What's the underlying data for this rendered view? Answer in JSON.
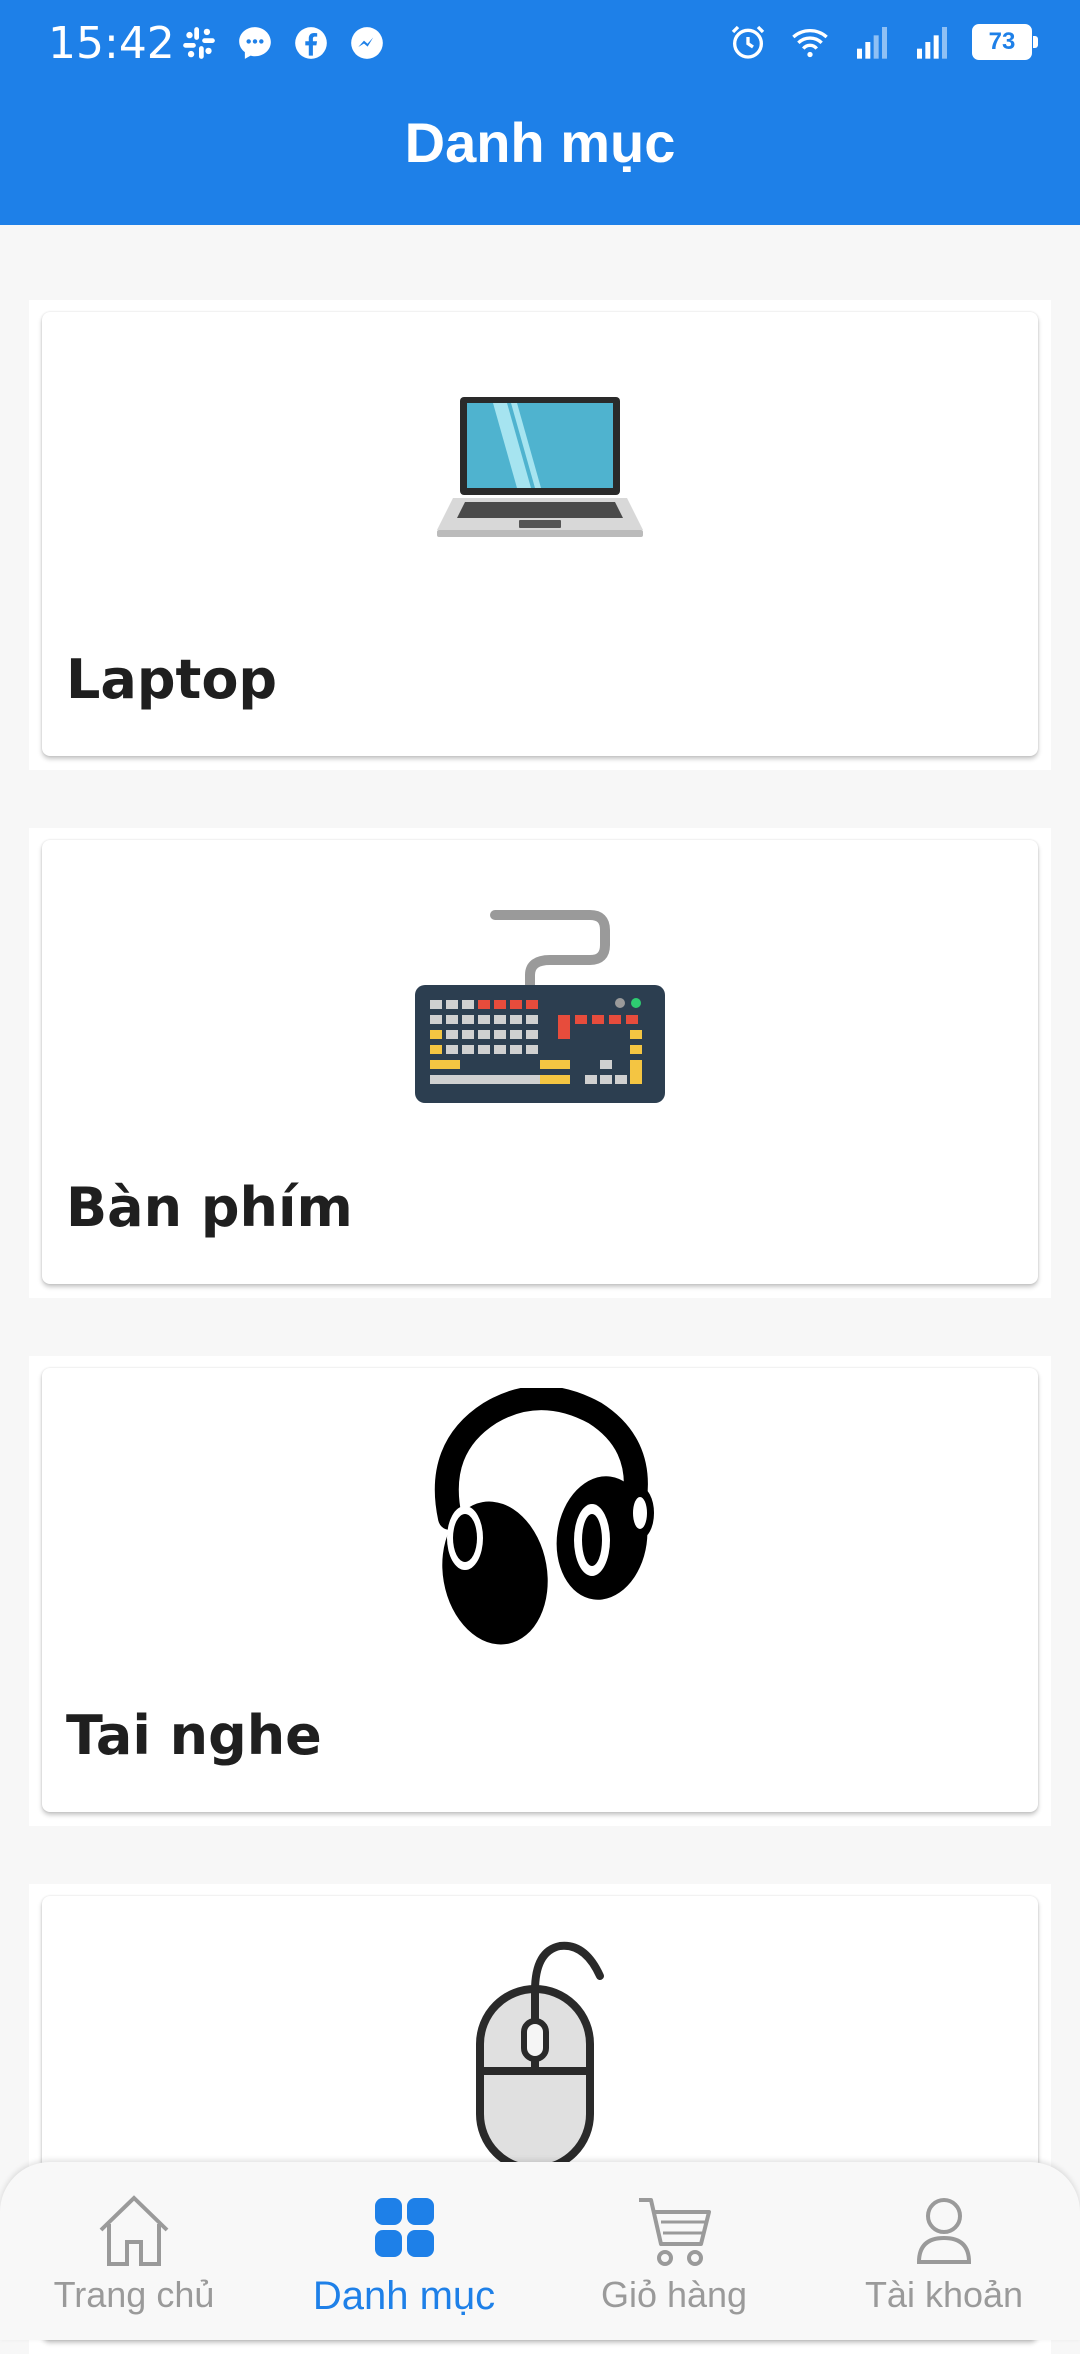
{
  "status_bar": {
    "time": "15:42",
    "battery": "73",
    "left_icons": [
      "slack-icon",
      "messenger-icon",
      "facebook-icon",
      "messenger-lite-icon"
    ],
    "right_icons": [
      "alarm-icon",
      "wifi-icon",
      "signal-icon",
      "signal-icon",
      "battery-icon"
    ]
  },
  "header": {
    "title": "Danh mục",
    "color": "#1e80e8"
  },
  "categories": [
    {
      "label": "Laptop",
      "icon": "laptop-icon"
    },
    {
      "label": "Bàn phím",
      "icon": "keyboard-icon"
    },
    {
      "label": "Tai nghe",
      "icon": "headphones-icon"
    },
    {
      "label": "",
      "icon": "mouse-icon"
    }
  ],
  "bottom_nav": {
    "items": [
      {
        "label": "Trang chủ",
        "icon": "home-icon"
      },
      {
        "label": "Danh mục",
        "icon": "grid-icon",
        "active": true
      },
      {
        "label": "Giỏ hàng",
        "icon": "cart-icon"
      },
      {
        "label": "Tài khoản",
        "icon": "user-icon"
      }
    ],
    "active_color": "#1e80e8",
    "inactive_color": "#9a9a9a"
  }
}
